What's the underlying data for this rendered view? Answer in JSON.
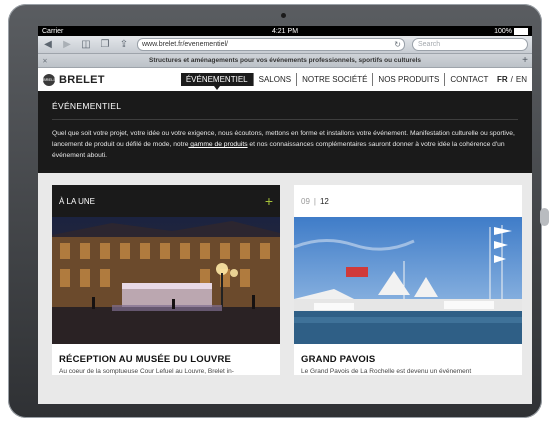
{
  "status_bar": {
    "carrier": "Carrier",
    "time": "4:21 PM",
    "battery": "100%"
  },
  "browser": {
    "url": "www.brelet.fr/evenementiel/",
    "search_placeholder": "Search",
    "page_title": "Structures et aménagements pour vos événements professionnels, sportifs ou culturels"
  },
  "site": {
    "logo_mark": "BRELET",
    "logo_text": "BRELET",
    "menu": [
      "ÉVÉNEMENTIEL",
      "SALONS",
      "NOTRE SOCIÉTÉ",
      "NOS PRODUITS",
      "CONTACT"
    ],
    "lang": {
      "fr": "FR",
      "sep": "/",
      "en": "EN"
    }
  },
  "intro": {
    "heading": "ÉVÉNEMENTIEL",
    "text_before": "Quel que soit votre projet, votre idée ou votre exigence, nous écoutons, mettons en forme et installons votre événement. Manifestation culturelle ou sportive, lancement de produit ou défilé de mode, notre",
    "link": " gamme de produits",
    "text_after": " et nos connaissances complémentaires sauront donner à votre idée la cohérence d'un événement abouti."
  },
  "cards": [
    {
      "label": "À LA UNE",
      "title": "RÉCEPTION AU MUSÉE DU LOUVRE",
      "text": "Au coeur de la somptueuse Cour Lefuel au Louvre, Brelet in-"
    },
    {
      "day": "09",
      "sep": "|",
      "month": "12",
      "title": "GRAND PAVOIS",
      "text": "Le Grand Pavois de La Rochelle est devenu un événement"
    }
  ],
  "colors": {
    "accent": "#a6c23a",
    "dark": "#1a1a1a"
  }
}
